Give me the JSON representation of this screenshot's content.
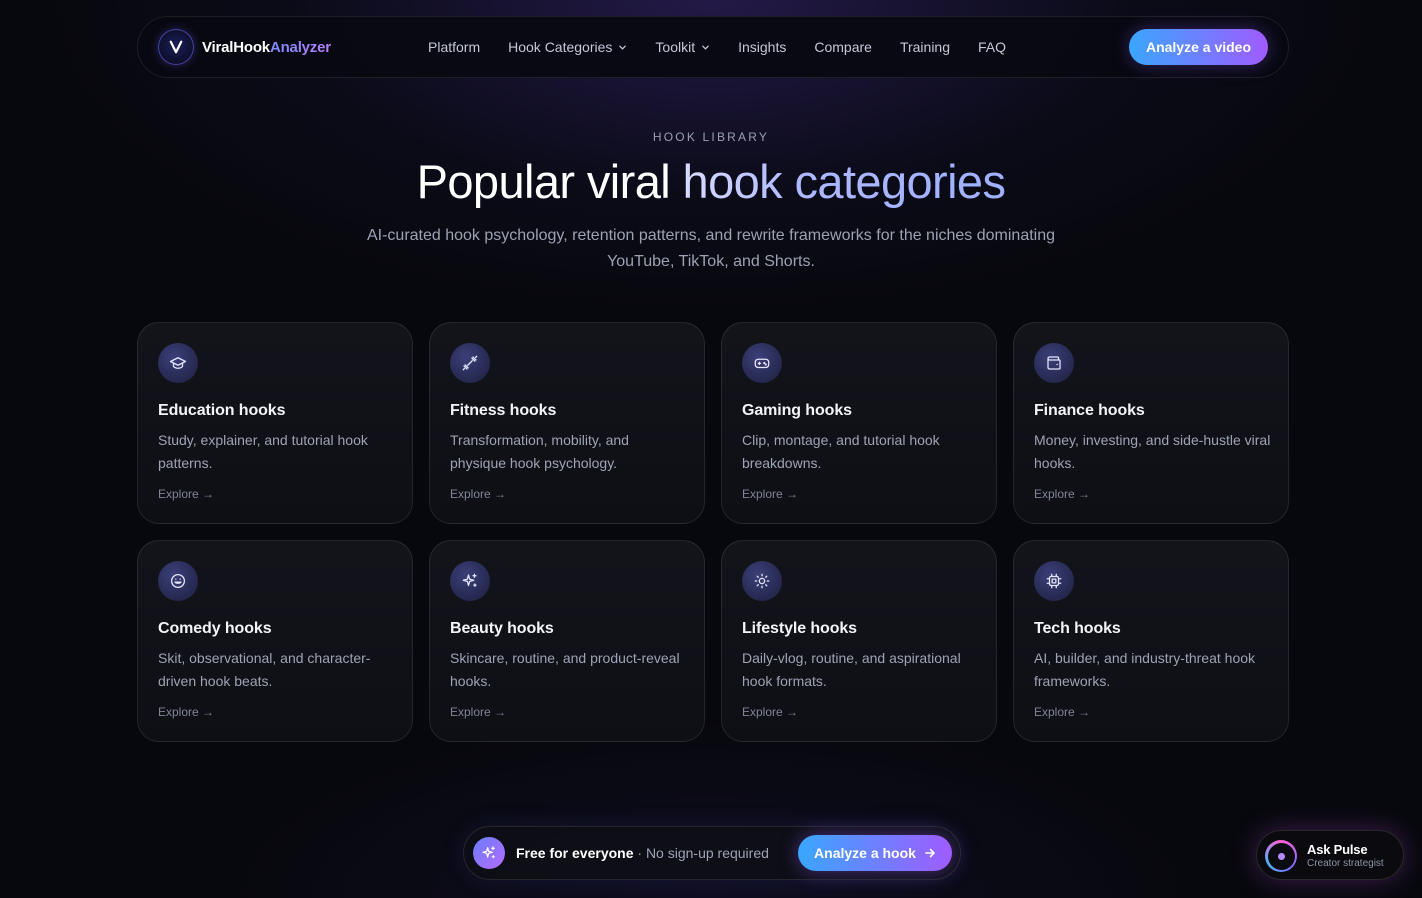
{
  "nav": {
    "brand_primary": "ViralHook",
    "brand_secondary": "Analyzer",
    "logo_icon": "v-logo-icon",
    "links": [
      {
        "label": "Platform",
        "dropdown": false
      },
      {
        "label": "Hook Categories",
        "dropdown": true
      },
      {
        "label": "Toolkit",
        "dropdown": true
      },
      {
        "label": "Insights",
        "dropdown": false
      },
      {
        "label": "Compare",
        "dropdown": false
      },
      {
        "label": "Training",
        "dropdown": false
      },
      {
        "label": "FAQ",
        "dropdown": false
      }
    ],
    "cta_label": "Analyze a video"
  },
  "hero": {
    "eyebrow": "HOOK LIBRARY",
    "title_plain": "Popular viral ",
    "title_gradient": "hook categories",
    "subtitle": "AI-curated hook psychology, retention patterns, and rewrite frameworks for the niches dominating YouTube, TikTok, and Shorts."
  },
  "categories": [
    {
      "icon": "graduation-cap-icon",
      "title": "Education hooks",
      "description": "Study, explainer, and tutorial hook patterns.",
      "link": "Explore →"
    },
    {
      "icon": "dumbbell-icon",
      "title": "Fitness hooks",
      "description": "Transformation, mobility, and physique hook psychology.",
      "link": "Explore →"
    },
    {
      "icon": "gamepad-icon",
      "title": "Gaming hooks",
      "description": "Clip, montage, and tutorial hook breakdowns.",
      "link": "Explore →"
    },
    {
      "icon": "wallet-icon",
      "title": "Finance hooks",
      "description": "Money, investing, and side-hustle viral hooks.",
      "link": "Explore →"
    },
    {
      "icon": "smile-icon",
      "title": "Comedy hooks",
      "description": "Skit, observational, and character-driven hook beats.",
      "link": "Explore →"
    },
    {
      "icon": "sparkles-icon",
      "title": "Beauty hooks",
      "description": "Skincare, routine, and product-reveal hooks.",
      "link": "Explore →"
    },
    {
      "icon": "sun-icon",
      "title": "Lifestyle hooks",
      "description": "Daily-vlog, routine, and aspirational hook formats.",
      "link": "Explore →"
    },
    {
      "icon": "cpu-icon",
      "title": "Tech hooks",
      "description": "AI, builder, and industry-threat hook frameworks.",
      "link": "Explore →"
    }
  ],
  "promo": {
    "strong": "Free for everyone",
    "muted": " · No sign-up required",
    "cta_label": "Analyze a hook"
  },
  "assistant": {
    "title": "Ask Pulse",
    "subtitle": "Creator strategist"
  },
  "colors": {
    "background": "#07080d",
    "accent_start": "#3aa6ff",
    "accent_end": "#a05bff",
    "card": "#13141b",
    "icon_bg": "#2e3263"
  }
}
